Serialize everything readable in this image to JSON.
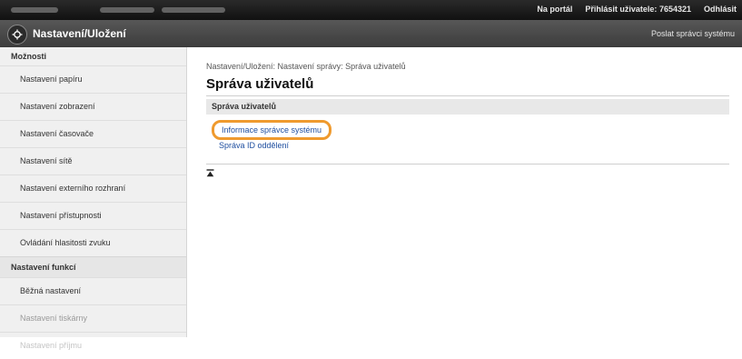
{
  "topbar": {
    "portal_link": "Na portál",
    "login_label": "Přihlásit uživatele:",
    "user_id": "7654321",
    "logout": "Odhlásit"
  },
  "titlebar": {
    "title": "Nastavení/Uložení",
    "mail_admin": "Poslat správci systému",
    "icon": "settings-save-icon"
  },
  "sidebar": {
    "header": "Možnosti",
    "items": [
      {
        "label": "Nastavení papíru"
      },
      {
        "label": "Nastavení zobrazení"
      },
      {
        "label": "Nastavení časovače"
      },
      {
        "label": "Nastavení sítě"
      },
      {
        "label": "Nastavení externího rozhraní"
      },
      {
        "label": "Nastavení přístupnosti"
      },
      {
        "label": "Ovládání hlasitosti zvuku"
      }
    ],
    "section": "Nastavení funkcí",
    "section_items": [
      {
        "label": "Běžná nastavení"
      },
      {
        "label": "Nastavení tiskárny"
      },
      {
        "label": "Nastavení příjmu"
      }
    ]
  },
  "main": {
    "breadcrumb": "Nastavení/Uložení: Nastavení správy: Správa uživatelů",
    "heading": "Správa uživatelů",
    "section_title": "Správa uživatelů",
    "links": [
      "Informace správce systému",
      "Správa ID oddělení"
    ]
  },
  "colors": {
    "highlight": "#ef9a2e",
    "link": "#1f4fa0",
    "topbar": "#1a1a1a"
  }
}
